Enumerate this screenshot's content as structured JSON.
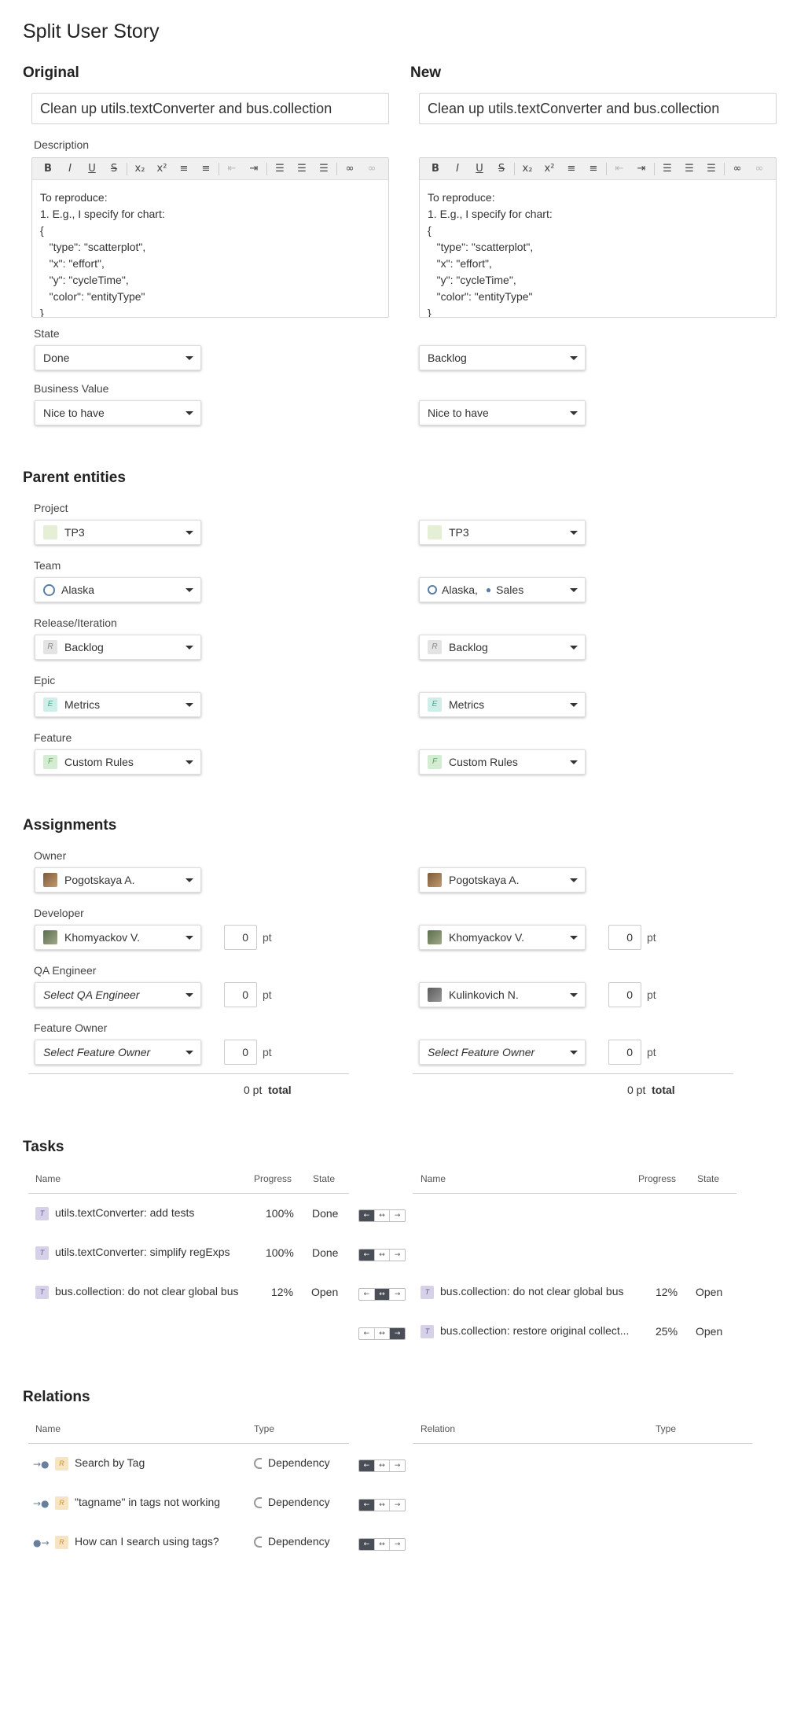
{
  "page": {
    "title": "Split User Story"
  },
  "columns": {
    "original": "Original",
    "new": "New"
  },
  "original": {
    "title": "Clean up utils.textConverter and bus.collection",
    "description": "To reproduce:\n1. E.g., I specify for chart:\n{\n   \"type\": \"scatterplot\",\n   \"x\": \"effort\",\n   \"y\": \"cycleTime\",\n   \"color\": \"entityType\"\n}",
    "state": "Done",
    "business_value": "Nice to have",
    "project": "TP3",
    "team": "Alaska",
    "release": "Backlog",
    "epic": "Metrics",
    "feature": "Custom Rules",
    "owner": "Pogotskaya A.",
    "developer": "Khomyackov V.",
    "qa": "Select QA Engineer",
    "feature_owner": "Select Feature Owner",
    "dev_pt": "0",
    "qa_pt": "0",
    "fo_pt": "0",
    "total": "0 pt"
  },
  "new": {
    "title": "Clean up utils.textConverter and bus.collection",
    "description": "To reproduce:\n1. E.g., I specify for chart:\n{\n   \"type\": \"scatterplot\",\n   \"x\": \"effort\",\n   \"y\": \"cycleTime\",\n   \"color\": \"entityType\"\n}",
    "state": "Backlog",
    "business_value": "Nice to have",
    "project": "TP3",
    "team": "Alaska,",
    "team2": "Sales",
    "release": "Backlog",
    "epic": "Metrics",
    "feature": "Custom Rules",
    "owner": "Pogotskaya A.",
    "developer": "Khomyackov V.",
    "qa": "Kulinkovich N.",
    "feature_owner": "Select Feature Owner",
    "dev_pt": "0",
    "qa_pt": "0",
    "fo_pt": "0",
    "total": "0 pt"
  },
  "labels": {
    "description": "Description",
    "state": "State",
    "business_value": "Business Value",
    "parent_entities": "Parent entities",
    "project": "Project",
    "team": "Team",
    "release": "Release/Iteration",
    "epic": "Epic",
    "feature": "Feature",
    "assignments": "Assignments",
    "owner": "Owner",
    "developer": "Developer",
    "qa": "QA Engineer",
    "feature_owner": "Feature Owner",
    "pt": "pt",
    "total": "total",
    "tasks": "Tasks",
    "relations": "Relations"
  },
  "tasks": {
    "headers": {
      "name": "Name",
      "progress": "Progress",
      "state": "State"
    },
    "left": [
      {
        "chip": "T",
        "name": "utils.textConverter: add tests",
        "progress": "100%",
        "state": "Done"
      },
      {
        "chip": "T",
        "name": "utils.textConverter: simplify regExps",
        "progress": "100%",
        "state": "Done"
      },
      {
        "chip": "T",
        "name": "bus.collection: do not clear global bus",
        "progress": "12%",
        "state": "Open"
      }
    ],
    "right": [
      {
        "chip": "T",
        "name": "bus.collection: do not clear global bus",
        "progress": "12%",
        "state": "Open"
      },
      {
        "chip": "T",
        "name": "bus.collection: restore original collect...",
        "progress": "25%",
        "state": "Open"
      }
    ]
  },
  "relations": {
    "headers": {
      "name": "Name",
      "type": "Type",
      "relation": "Relation",
      "type2": "Type"
    },
    "items": [
      {
        "chip": "R",
        "name": "Search by Tag",
        "type": "Dependency"
      },
      {
        "chip": "R",
        "name": "\"tagname\" in tags not working",
        "type": "Dependency"
      },
      {
        "chip": "R",
        "name": "How can I search using tags?",
        "type": "Dependency"
      }
    ]
  },
  "editor_toolbar": {
    "bold": "B",
    "italic": "I",
    "underline": "U",
    "strike": "S",
    "sub": "x₂",
    "sup": "x²",
    "ol": "≡",
    "ul": "≡"
  },
  "mover": {
    "left": "←",
    "both": "↔",
    "right": "→"
  },
  "direction_icons": {
    "outgoing": "→●",
    "incoming": "●→"
  },
  "chip_letters": {
    "release": "R",
    "epic": "E",
    "feature": "F"
  }
}
